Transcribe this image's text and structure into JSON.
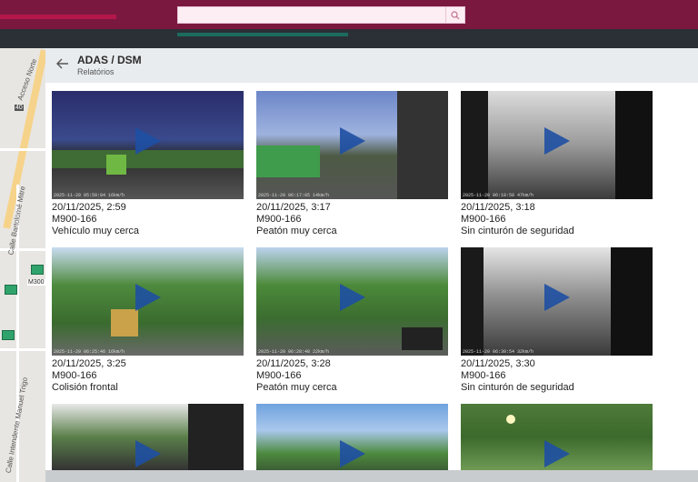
{
  "search": {
    "placeholder": ""
  },
  "header": {
    "title": "ADAS / DSM",
    "subtitle": "Relatórios"
  },
  "map": {
    "labels": [
      "Acceso Norte",
      "40",
      "Calle Bartolomé Mitre",
      "Calle Intendente Manuel Trigo",
      "M300"
    ]
  },
  "events": [
    {
      "datetime": "20/11/2025, 2:59",
      "vehicle": "M900-166",
      "event": "Vehículo muy cerca",
      "stamp": "2025-11-20 05:59:04 16km/h"
    },
    {
      "datetime": "20/11/2025, 3:17",
      "vehicle": "M900-166",
      "event": "Peatón muy cerca",
      "stamp": "2025-11-20 06:17:05 14km/h"
    },
    {
      "datetime": "20/11/2025, 3:18",
      "vehicle": "M900-166",
      "event": "Sin cinturón de seguridad",
      "stamp": "2025-11-20 06:18:58 47km/h"
    },
    {
      "datetime": "20/11/2025, 3:25",
      "vehicle": "M900-166",
      "event": "Colisión frontal",
      "stamp": "2025-11-20 06:25:46 16km/h"
    },
    {
      "datetime": "20/11/2025, 3:28",
      "vehicle": "M900-166",
      "event": "Peatón muy cerca",
      "stamp": "2025-11-20 06:28:48 22km/h"
    },
    {
      "datetime": "20/11/2025, 3:30",
      "vehicle": "M900-166",
      "event": "Sin cinturón de seguridad",
      "stamp": "2025-11-20 06:30:54 32km/h"
    },
    {
      "datetime": "",
      "vehicle": "",
      "event": "",
      "stamp": ""
    },
    {
      "datetime": "",
      "vehicle": "",
      "event": "",
      "stamp": ""
    },
    {
      "datetime": "",
      "vehicle": "",
      "event": "",
      "stamp": ""
    }
  ],
  "colors": {
    "brand": "#7a1840",
    "play": "#1e4fa3"
  },
  "icons": {
    "search": "search-icon",
    "back": "arrow-left-icon",
    "play": "play-icon"
  }
}
